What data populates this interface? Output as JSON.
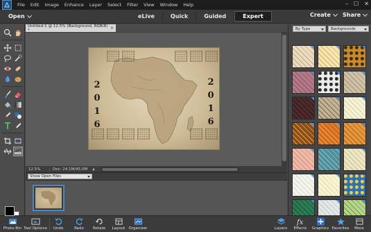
{
  "menubar": {
    "items": [
      "File",
      "Edit",
      "Image",
      "Enhance",
      "Layer",
      "Select",
      "Filter",
      "View",
      "Window",
      "Help"
    ],
    "window_controls": [
      "–",
      "☐",
      "✕"
    ]
  },
  "topbar": {
    "open_label": "Open",
    "modes": [
      {
        "label": "eLive",
        "active": false
      },
      {
        "label": "Quick",
        "active": false
      },
      {
        "label": "Guided",
        "active": false
      },
      {
        "label": "Expert",
        "active": true
      }
    ],
    "create_label": "Create",
    "share_label": "Share"
  },
  "document": {
    "tab_title": "Untitled-1 @ 12.5% (Background, RGB/8) *",
    "tab_close": "×",
    "zoom": "12.5%",
    "doc_info": "Doc: 24.1M/45.0M",
    "year_left": [
      "2",
      "0",
      "1",
      "6"
    ],
    "year_right": [
      "2",
      "0",
      "1",
      "6"
    ]
  },
  "photo_bin": {
    "selector_value": "Show Open Files"
  },
  "right_panel": {
    "filter_value": "By Type",
    "category_value": "Backgrounds",
    "swatches": [
      {
        "color": "#e9dcc3",
        "accent": "#c9a77c",
        "pattern": "paper"
      },
      {
        "color": "#f1e7b8",
        "accent": "#e7a842",
        "pattern": "paper-note"
      },
      {
        "color": "#c98b2b",
        "accent": "#3b2a12",
        "pattern": "leopard"
      },
      {
        "color": "#b27a86",
        "accent": "#8e5566",
        "pattern": "texture"
      },
      {
        "color": "#ececec",
        "accent": "#2a2a2a",
        "pattern": "zebra"
      },
      {
        "color": "#cfc0a8",
        "accent": "#a39271",
        "pattern": "map"
      },
      {
        "color": "#4d2a2c",
        "accent": "#2d1718",
        "pattern": "dark"
      },
      {
        "color": "#c2b396",
        "accent": "#7b6a4a",
        "pattern": "wood"
      },
      {
        "color": "#f4f2d7",
        "accent": "#d9d2a6",
        "pattern": "cream"
      },
      {
        "color": "#8a4d1e",
        "accent": "#e1a13a",
        "pattern": "autumn"
      },
      {
        "color": "#d46a24",
        "accent": "#f2b13b",
        "pattern": "leaves"
      },
      {
        "color": "#e49a3a",
        "accent": "#b45a1d",
        "pattern": "leaves-2"
      },
      {
        "color": "#ebbaa9",
        "accent": "#d98d79",
        "pattern": "peach"
      },
      {
        "color": "#4f8f9a",
        "accent": "#8fc0c4",
        "pattern": "teal"
      },
      {
        "color": "#ede6c6",
        "accent": "#c9c18c",
        "pattern": "lined"
      },
      {
        "color": "#f4f4ef",
        "accent": "#d8d8cc",
        "pattern": "white"
      },
      {
        "color": "#f7f3d6",
        "accent": "#e7dfa2",
        "pattern": "light"
      },
      {
        "color": "#2d6fb8",
        "accent": "#f3d13a",
        "pattern": "dots"
      },
      {
        "color": "#2b7b54",
        "accent": "#1b5238",
        "pattern": "green"
      },
      {
        "color": "#e3e7e8",
        "accent": "#c0c8cb",
        "pattern": "grey"
      },
      {
        "color": "#b8d48e",
        "accent": "#6d9d3e",
        "pattern": "lime"
      }
    ]
  },
  "taskbar": {
    "left": [
      {
        "label": "Photo Bin",
        "icon": "photo-bin-icon"
      },
      {
        "label": "Tool Options",
        "icon": "tool-options-icon"
      },
      {
        "label": "Undo",
        "icon": "undo-icon"
      },
      {
        "label": "Redo",
        "icon": "redo-icon"
      },
      {
        "label": "Rotate",
        "icon": "rotate-icon"
      },
      {
        "label": "Layout",
        "icon": "layout-icon"
      },
      {
        "label": "Organizer",
        "icon": "organizer-icon"
      }
    ],
    "right": [
      {
        "label": "Layers",
        "icon": "layers-icon"
      },
      {
        "label": "Effects",
        "icon": "effects-icon"
      },
      {
        "label": "Graphics",
        "icon": "graphics-icon"
      },
      {
        "label": "Favorites",
        "icon": "favorites-icon"
      },
      {
        "label": "More",
        "icon": "more-icon"
      }
    ]
  },
  "colors": {
    "accent": "#4b86c6",
    "menubar_bg": "#1d1d1d",
    "panel_bg": "#454545"
  }
}
